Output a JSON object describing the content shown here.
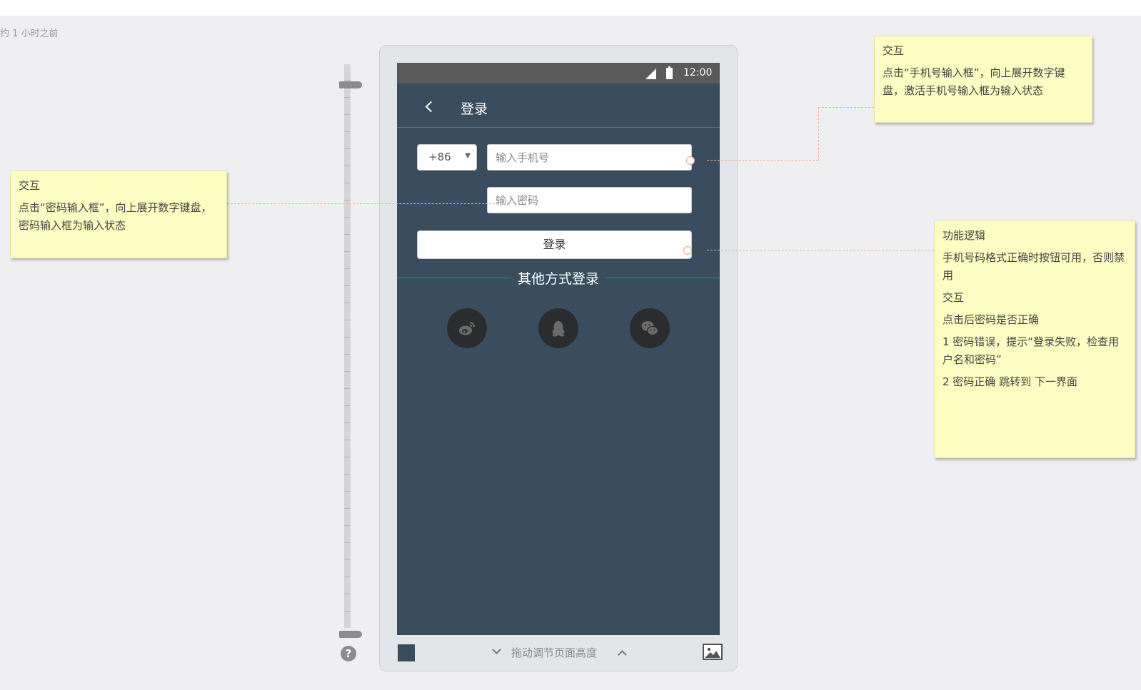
{
  "timestamp": "约 1 小时之前",
  "status_bar": {
    "time": "12:00"
  },
  "header": {
    "title": "登录"
  },
  "form": {
    "country_code": "+86",
    "phone_placeholder": "输入手机号",
    "password_placeholder": "输入密码",
    "login_label": "登录"
  },
  "other_login": {
    "label": "其他方式登录",
    "providers": [
      "weibo-icon",
      "qq-icon",
      "wechat-icon"
    ]
  },
  "bottom_bar": {
    "drag_label": "拖动调节页面高度"
  },
  "notes": {
    "password": {
      "title": "交互",
      "body": "点击“密码输入框”，向上展开数字键盘，密码输入框为输入状态"
    },
    "phone": {
      "title": "交互",
      "body": "点击“手机号输入框”，向上展开数字键盘，激活手机号输入框为输入状态"
    },
    "login": {
      "logic_title": "功能逻辑",
      "logic_body": "手机号码格式正确时按钮可用，否则禁用",
      "interact_title": "交互",
      "line1": "点击后密码是否正确",
      "line2": "1 密码错误，提示“登录失败，检查用户名和密码”",
      "line3": "2 密码正确 跳转到 下一界面"
    }
  },
  "colors": {
    "screen_bg": "#394d5e",
    "status_bar": "#5a5a5a",
    "accent_line": "#2c8c8a",
    "note_bg": "#fdfcc3",
    "connector": "#f2b08a"
  }
}
